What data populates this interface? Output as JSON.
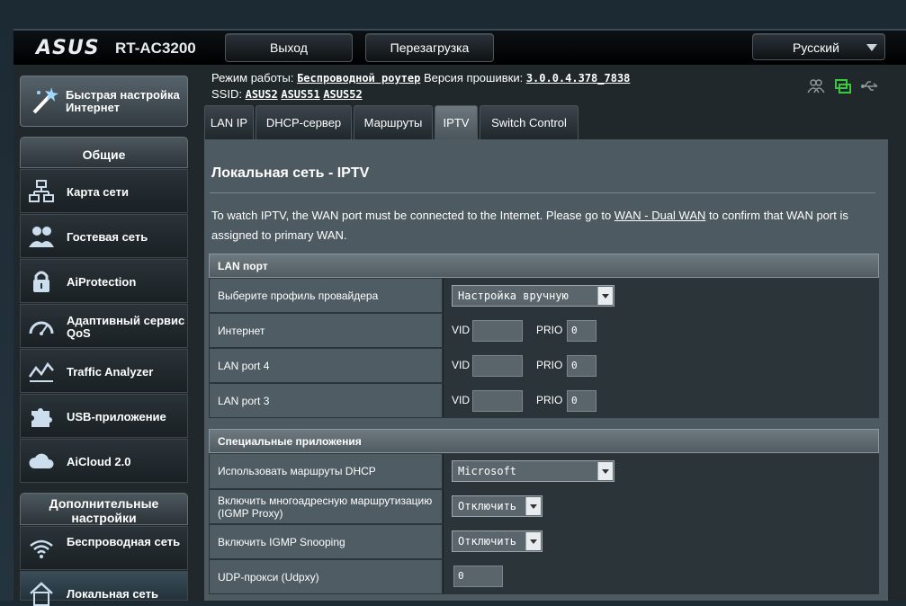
{
  "header": {
    "logo": "ASUS",
    "model": "RT-AC3200",
    "logout_label": "Выход",
    "reboot_label": "Перезагрузка",
    "language": "Русский"
  },
  "info": {
    "mode_label": "Режим работы:",
    "mode_value": "Беспроводной роутер",
    "firmware_label": "Версия прошивки:",
    "firmware_value": "3.0.0.4.378_7838",
    "ssid_label": "SSID:",
    "ssids": [
      "ASUS2",
      "ASUS51",
      "ASUS52"
    ]
  },
  "sidebar": {
    "quick_setup": "Быстрая настройка Интернет",
    "general_title": "Общие",
    "items": [
      {
        "label": "Карта сети",
        "icon": "network-map-icon"
      },
      {
        "label": "Гостевая сеть",
        "icon": "guest-network-icon"
      },
      {
        "label": "AiProtection",
        "icon": "lock-icon"
      },
      {
        "label": "Адаптивный сервис QoS",
        "icon": "speedometer-icon"
      },
      {
        "label": "Traffic Analyzer",
        "icon": "chart-icon"
      },
      {
        "label": "USB-приложение",
        "icon": "puzzle-icon"
      },
      {
        "label": "AiCloud 2.0",
        "icon": "cloud-icon"
      }
    ],
    "advanced_title": "Дополнительные настройки",
    "advanced_items": [
      {
        "label": "Беспроводная сеть",
        "icon": "wifi-icon"
      },
      {
        "label": "Локальная сеть",
        "icon": "home-icon"
      }
    ]
  },
  "tabs": [
    "LAN IP",
    "DHCP-сервер",
    "Маршруты",
    "IPTV",
    "Switch Control"
  ],
  "active_tab": "IPTV",
  "page": {
    "title": "Локальная сеть - IPTV",
    "desc_before": "To watch IPTV, the WAN port must be connected to the Internet. Please go to ",
    "desc_link": "WAN - Dual WAN",
    "desc_after": " to confirm that WAN port is assigned to primary WAN."
  },
  "lan_port": {
    "title": "LAN порт",
    "profile_label": "Выберите профиль провайдера",
    "profile_value": "Настройка вручную",
    "vid_label": "VID",
    "prio_label": "PRIO",
    "ports": [
      {
        "label": "Интернет",
        "vid": "",
        "prio": "0"
      },
      {
        "label": "LAN port 4",
        "vid": "",
        "prio": "0"
      },
      {
        "label": "LAN port 3",
        "vid": "",
        "prio": "0"
      }
    ]
  },
  "special": {
    "title": "Специальные приложения",
    "dhcp_label": "Использовать маршруты DHCP",
    "dhcp_value": "Microsoft",
    "igmp_proxy_label": "Включить многоадресную маршрутизацию (IGMP Proxy)",
    "igmp_proxy_value": "Отключить",
    "igmp_snoop_label": "Включить IGMP Snooping",
    "igmp_snoop_value": "Отключить",
    "udpxy_label": "UDP-прокси (Udpxy)",
    "udpxy_value": "0"
  },
  "colors": {
    "background": "#20282c",
    "panel": "#4d5a61",
    "usb_icon_active": "#3cc83c"
  }
}
